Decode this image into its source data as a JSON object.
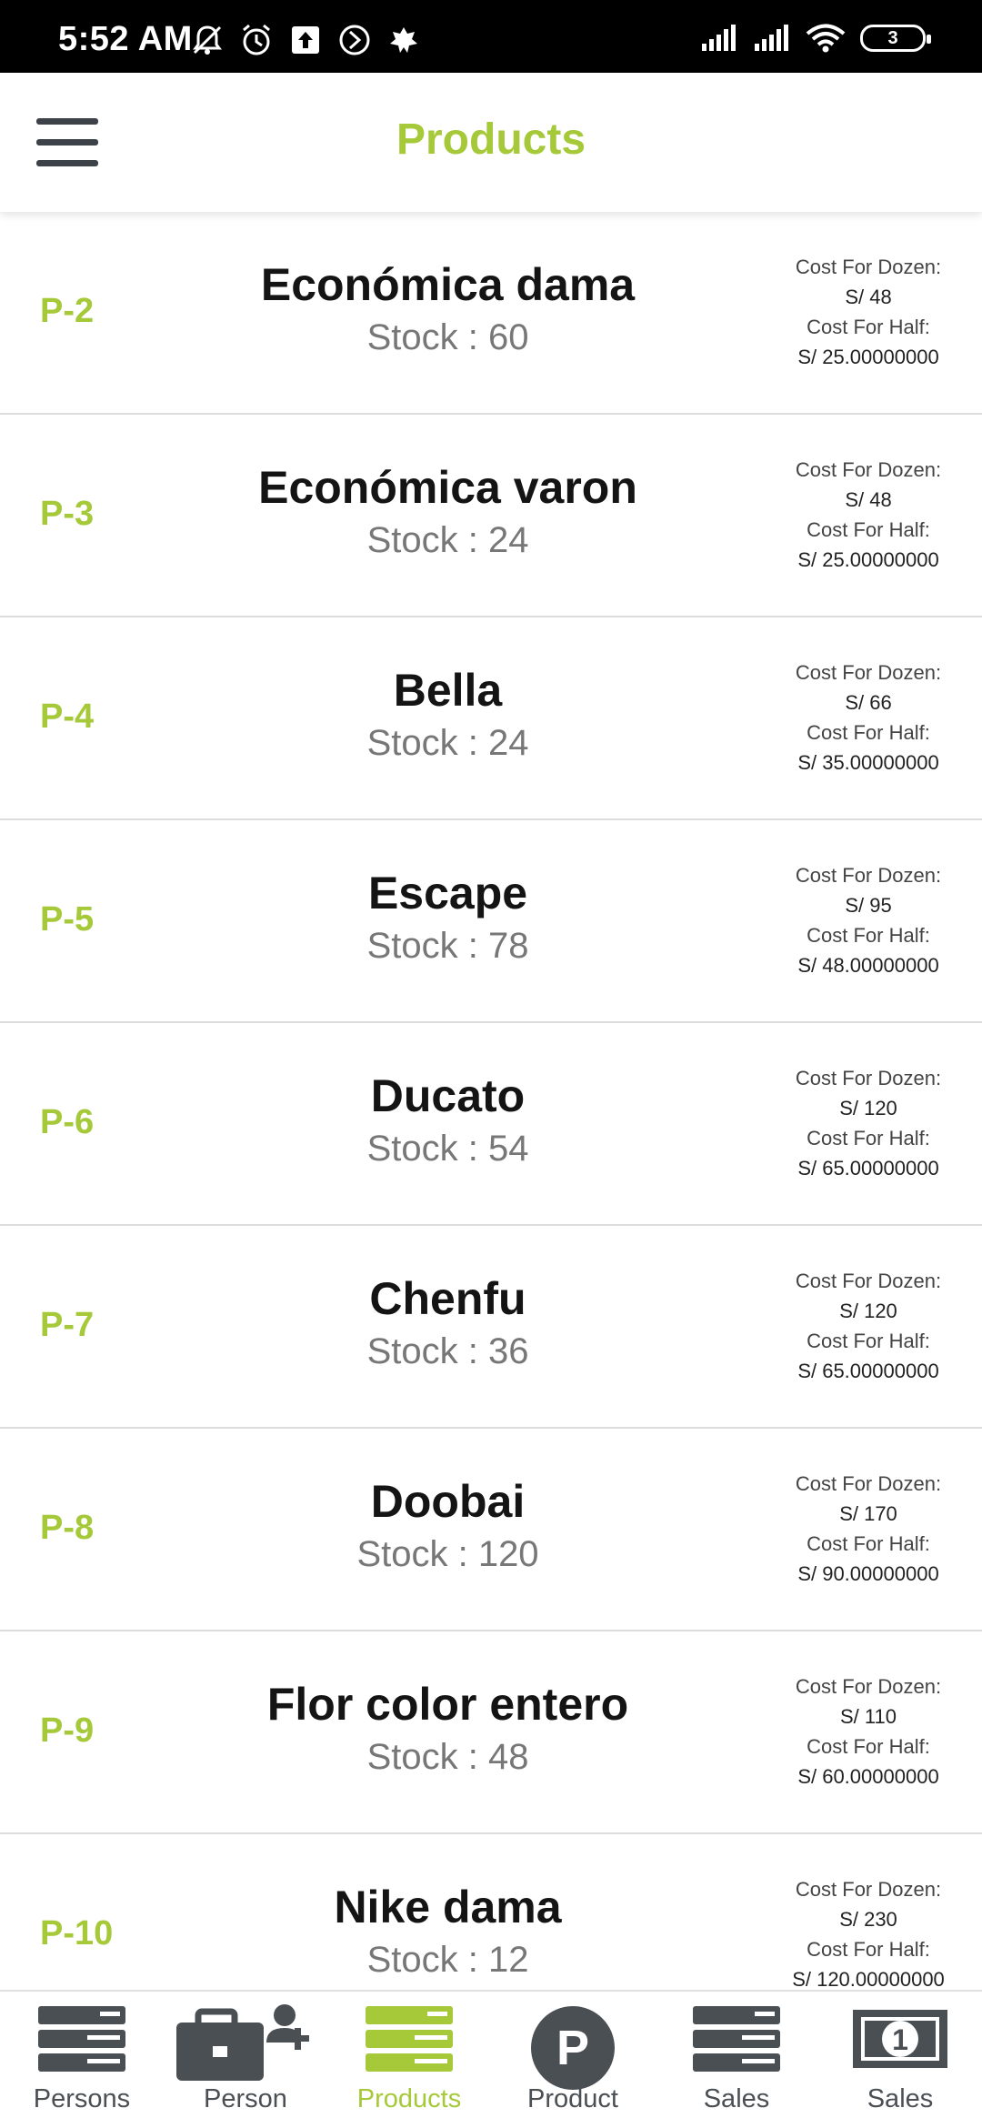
{
  "status_bar": {
    "time": "5:52 AM",
    "battery": "3",
    "icons_left": [
      "mute-bell-icon",
      "alarm-icon",
      "upload-icon",
      "arrow-circle-icon",
      "leaf-icon"
    ],
    "icons_right": [
      "signal-icon",
      "signal-icon",
      "wifi-icon",
      "battery-icon"
    ]
  },
  "app_bar": {
    "title": "Products",
    "menu_icon": "hamburger-menu-icon"
  },
  "colors": {
    "accent": "#a6c93a",
    "icon_dark": "#4a4f54"
  },
  "products": [
    {
      "code": "P-2",
      "name": "Económica dama",
      "stock": "Stock : 60",
      "dozen_label": "Cost For Dozen:",
      "dozen_value": "S/ 48",
      "half_label": "Cost For Half:",
      "half_value": "S/ 25.00000000"
    },
    {
      "code": "P-3",
      "name": "Económica varon",
      "stock": "Stock : 24",
      "dozen_label": "Cost For Dozen:",
      "dozen_value": "S/ 48",
      "half_label": "Cost For Half:",
      "half_value": "S/ 25.00000000"
    },
    {
      "code": "P-4",
      "name": "Bella",
      "stock": "Stock : 24",
      "dozen_label": "Cost For Dozen:",
      "dozen_value": "S/ 66",
      "half_label": "Cost For Half:",
      "half_value": "S/ 35.00000000"
    },
    {
      "code": "P-5",
      "name": "Escape",
      "stock": "Stock : 78",
      "dozen_label": "Cost For Dozen:",
      "dozen_value": "S/ 95",
      "half_label": "Cost For Half:",
      "half_value": "S/ 48.00000000"
    },
    {
      "code": "P-6",
      "name": "Ducato",
      "stock": "Stock : 54",
      "dozen_label": "Cost For Dozen:",
      "dozen_value": "S/ 120",
      "half_label": "Cost For Half:",
      "half_value": "S/ 65.00000000"
    },
    {
      "code": "P-7",
      "name": "Chenfu",
      "stock": "Stock : 36",
      "dozen_label": "Cost For Dozen:",
      "dozen_value": "S/ 120",
      "half_label": "Cost For Half:",
      "half_value": "S/ 65.00000000"
    },
    {
      "code": "P-8",
      "name": "Doobai",
      "stock": "Stock : 120",
      "dozen_label": "Cost For Dozen:",
      "dozen_value": "S/ 170",
      "half_label": "Cost For Half:",
      "half_value": "S/ 90.00000000"
    },
    {
      "code": "P-9",
      "name": "Flor color entero",
      "stock": "Stock : 48",
      "dozen_label": "Cost For Dozen:",
      "dozen_value": "S/ 110",
      "half_label": "Cost For Half:",
      "half_value": "S/ 60.00000000"
    },
    {
      "code": "P-10",
      "name": "Nike dama",
      "stock": "Stock : 12",
      "dozen_label": "Cost For Dozen:",
      "dozen_value": "S/ 230",
      "half_label": "Cost For Half:",
      "half_value": "S/ 120.00000000"
    }
  ],
  "bottom_nav": [
    {
      "label": "Persons",
      "icon": "list-icon",
      "active": false
    },
    {
      "label": "Person",
      "icon": "briefcase-add-person-icon",
      "active": false
    },
    {
      "label": "Products",
      "icon": "list-icon",
      "active": true
    },
    {
      "label": "Product",
      "icon": "parking-p-icon",
      "active": false
    },
    {
      "label": "Sales",
      "icon": "list-icon",
      "active": false
    },
    {
      "label": "Sales",
      "icon": "banknote-icon",
      "active": false
    }
  ]
}
